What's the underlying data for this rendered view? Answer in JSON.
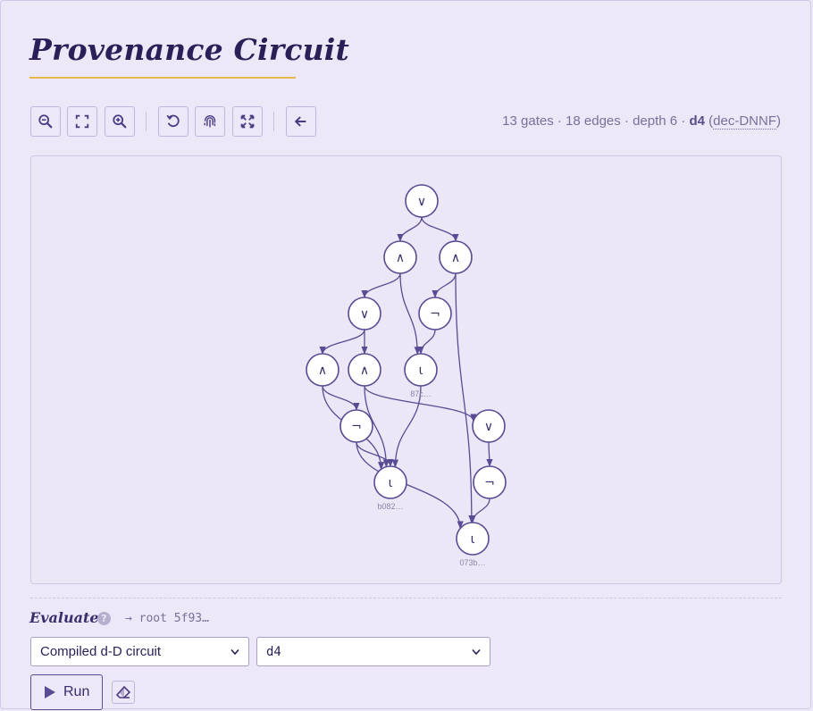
{
  "title": "Provenance Circuit",
  "stats": {
    "summary": "13 gates · 18 edges · depth 6 · ",
    "method": "d4",
    "format_open": " (",
    "format": "dec-DNNF",
    "format_close": ")"
  },
  "toolbar": {
    "buttons": [
      {
        "name": "zoom-out",
        "icon": "zoom-out-icon"
      },
      {
        "name": "fit",
        "icon": "fit-icon"
      },
      {
        "name": "zoom-in",
        "icon": "zoom-in-icon"
      },
      {
        "name": "reset",
        "icon": "undo-icon"
      },
      {
        "name": "fingerprint",
        "icon": "fingerprint-icon"
      },
      {
        "name": "fullscreen",
        "icon": "expand-icon"
      },
      {
        "name": "back",
        "icon": "arrow-left-icon"
      }
    ]
  },
  "circuit": {
    "nodes": [
      {
        "id": "n1",
        "label": "∨"
      },
      {
        "id": "n2",
        "label": "∧"
      },
      {
        "id": "n3",
        "label": "∧"
      },
      {
        "id": "n4",
        "label": "∨"
      },
      {
        "id": "n5",
        "label": "¬"
      },
      {
        "id": "n6",
        "label": "∧"
      },
      {
        "id": "n7",
        "label": "∧"
      },
      {
        "id": "n8",
        "label": "ι"
      },
      {
        "id": "n9",
        "label": "¬"
      },
      {
        "id": "n10",
        "label": "∨"
      },
      {
        "id": "n11",
        "label": "ι"
      },
      {
        "id": "n12",
        "label": "¬"
      },
      {
        "id": "n13",
        "label": "ι"
      }
    ],
    "leaf_ids": {
      "n8": "87c…",
      "n11": "b082…",
      "n13": "073b…"
    }
  },
  "evaluate": {
    "label": "Evaluate",
    "root_ref": "→ root 5f93…",
    "semiring_select": "Compiled d-D circuit",
    "method_select": "d4",
    "run_label": "Run"
  }
}
